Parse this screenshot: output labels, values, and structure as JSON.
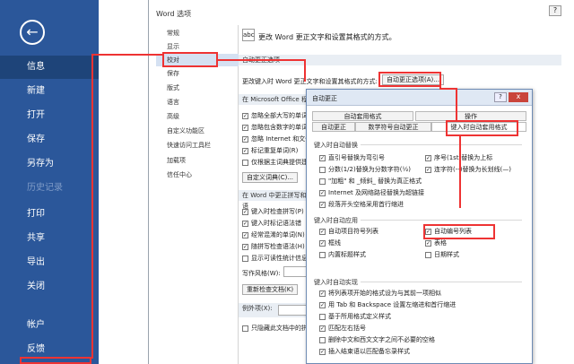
{
  "backstage": {
    "back_glyph": "←",
    "items": [
      "信息",
      "新建",
      "打开",
      "保存",
      "另存为",
      "历史记录",
      "打印",
      "共享",
      "导出",
      "关闭",
      "帐户",
      "反馈"
    ]
  },
  "options": {
    "title": "Word 选项",
    "help": "?",
    "nav": [
      "常规",
      "显示",
      "校对",
      "保存",
      "版式",
      "语言",
      "高级",
      "自定义功能区",
      "快速访问工具栏",
      "加载项",
      "信任中心"
    ],
    "header_text": "更改 Word 更正文字和设置其格式的方式。",
    "abc": "abc",
    "sec_autocorrect": "自动更正选项",
    "autocorrect_desc": "更改键入时 Word 更正文字和设置其格式的方式:",
    "autocorrect_btn": "自动更正选项(A)...",
    "sec_office": "在 Microsoft Office 程",
    "office_items": [
      "忽略全部大写的单词",
      "忽略包含数字的单词",
      "忽略 Internet 和文件",
      "标记重复单词(R)",
      "仅根据主词典提供建"
    ],
    "custom_dict_btn": "自定义词典(C)...",
    "sec_word": "在 Word 中更正拼写和语",
    "word_items": [
      "键入时检查拼写(P)",
      "键入时标记语法错",
      "经常混淆的单词(N)",
      "随拼写检查语法(H)",
      "显示可读性统计信息"
    ],
    "writing_style_label": "写作风格(W):",
    "writing_style_value": "",
    "recheck_btn": "重新检查文档(K)",
    "exceptions_label": "例外项(X):",
    "exceptions_value": "",
    "last_item": "只隐藏此文档中的拼写"
  },
  "autocorrect": {
    "title": "自动更正",
    "help": "?",
    "close": "x",
    "tabs_row1": [
      "自动套用格式",
      "操作"
    ],
    "tabs_row2": [
      "自动更正",
      "数学符号自动更正",
      "键入时自动套用格式"
    ],
    "grp_replace": "键入时自动替换",
    "replace_left": [
      "直引号替换为弯引号",
      "分数(1/2)替换为分数字符(½)",
      "\"加粗\" 和 _倾斜_ 替换为真正格式",
      "Internet 及网络路径替换为超链接",
      "段落开头空格采用首行缩进"
    ],
    "replace_left_checked": [
      true,
      false,
      false,
      true,
      true
    ],
    "replace_right": [
      "序号(1st)替换为上标",
      "连字符(--)替换为长划线(—)"
    ],
    "replace_right_checked": [
      true,
      true
    ],
    "grp_apply": "键入时自动应用",
    "apply_left": [
      "自动项目符号列表",
      "框线",
      "内置标题样式"
    ],
    "apply_left_checked": [
      true,
      true,
      false
    ],
    "apply_right": [
      "自动编号列表",
      "表格",
      "日期样式"
    ],
    "apply_right_checked": [
      true,
      true,
      false
    ],
    "grp_implement": "键入时自动实现",
    "implement_items": [
      "将列表项开始的格式设为与其前一项相似",
      "用 Tab 和 Backspace 设置左缩进和首行缩进",
      "基于所用格式定义样式",
      "匹配左右括号",
      "删除中文和西文文字之间不必要的空格",
      "插入结束语以匹配备忘录样式"
    ],
    "implement_checked": [
      true,
      true,
      false,
      true,
      false,
      true
    ],
    "check_mark": "✓"
  }
}
